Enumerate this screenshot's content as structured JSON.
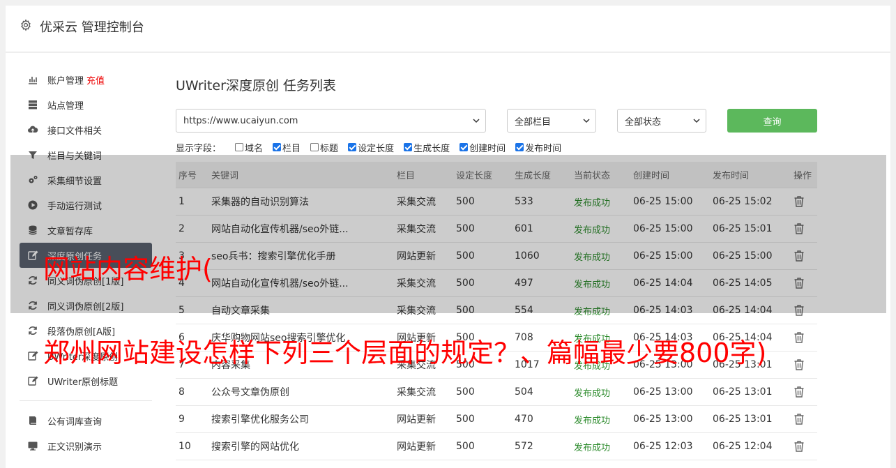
{
  "header": {
    "title": "优采云 管理控制台",
    "icon": "gear-icon"
  },
  "sidebar": {
    "items": [
      {
        "label": "账户管理",
        "badge": "充值",
        "icon": "bar-chart-icon"
      },
      {
        "label": "站点管理",
        "icon": "server-icon"
      },
      {
        "label": "接口文件相关",
        "icon": "cloud-upload-icon"
      },
      {
        "label": "栏目与关键词",
        "icon": "filter-icon"
      },
      {
        "label": "采集细节设置",
        "icon": "cogs-icon"
      },
      {
        "label": "手动运行测试",
        "icon": "play-icon"
      },
      {
        "label": "文章暂存库",
        "icon": "database-icon"
      },
      {
        "label": "深度原创任务",
        "icon": "edit-icon",
        "active": true
      },
      {
        "label": "同义词伪原创[1版]",
        "icon": "refresh-icon"
      },
      {
        "label": "同义词伪原创[2版]",
        "icon": "refresh-icon"
      },
      {
        "label": "段落伪原创[A版]",
        "icon": "refresh-icon"
      },
      {
        "label": "UWriter深度原创",
        "icon": "edit-icon"
      },
      {
        "label": "UWriter原创标题",
        "icon": "edit-icon"
      }
    ],
    "items2": [
      {
        "label": "公有词库查询",
        "icon": "book-icon"
      },
      {
        "label": "正文识别演示",
        "icon": "monitor-icon"
      }
    ]
  },
  "main": {
    "title": "UWriter深度原创 任务列表",
    "site_select": "https://www.ucaiyun.com",
    "column_select": "全部栏目",
    "status_select": "全部状态",
    "query_button": "查询",
    "fields_label": "显示字段：",
    "fields": [
      {
        "label": "域名",
        "checked": false
      },
      {
        "label": "栏目",
        "checked": true
      },
      {
        "label": "标题",
        "checked": false
      },
      {
        "label": "设定长度",
        "checked": true
      },
      {
        "label": "生成长度",
        "checked": true
      },
      {
        "label": "创建时间",
        "checked": true
      },
      {
        "label": "发布时间",
        "checked": true
      }
    ],
    "table": {
      "headers": [
        "序号",
        "关键词",
        "栏目",
        "设定长度",
        "生成长度",
        "当前状态",
        "创建时间",
        "发布时间",
        "操作"
      ],
      "rows": [
        [
          "1",
          "采集器的自动识别算法",
          "采集交流",
          "500",
          "533",
          "发布成功",
          "06-25 15:00",
          "06-25 15:02"
        ],
        [
          "2",
          "网站自动化宣传机器/seo外链...",
          "采集交流",
          "500",
          "601",
          "发布成功",
          "06-25 15:00",
          "06-25 15:01"
        ],
        [
          "3",
          "seo兵书：搜索引擎优化手册",
          "网站更新",
          "500",
          "1060",
          "发布成功",
          "06-25 15:00",
          "06-25 15:00"
        ],
        [
          "4",
          "网站自动化宣传机器/seo外链...",
          "采集交流",
          "500",
          "497",
          "发布成功",
          "06-25 14:04",
          "06-25 14:05"
        ],
        [
          "5",
          "自动文章采集",
          "采集交流",
          "500",
          "554",
          "发布成功",
          "06-25 14:03",
          "06-25 14:04"
        ],
        [
          "6",
          "庆华购物网站seo搜索引擎优化",
          "网站更新",
          "500",
          "708",
          "发布成功",
          "06-25 14:03",
          "06-25 14:04"
        ],
        [
          "7",
          "内容采集",
          "采集交流",
          "500",
          "1017",
          "发布成功",
          "06-25 13:00",
          "06-25 13:01"
        ],
        [
          "8",
          "公众号文章伪原创",
          "采集交流",
          "500",
          "504",
          "发布成功",
          "06-25 13:00",
          "06-25 13:01"
        ],
        [
          "9",
          "搜索引擎优化服务公司",
          "网站更新",
          "500",
          "470",
          "发布成功",
          "06-25 13:00",
          "06-25 13:01"
        ],
        [
          "10",
          "搜索引擎的网站优化",
          "网站更新",
          "500",
          "572",
          "发布成功",
          "06-25 12:03",
          "06-25 12:04"
        ]
      ]
    }
  },
  "overlay": {
    "line1": "网站内容维护(",
    "line2": "郑州网站建设怎样下列三个层面的规定？、篇幅最少要800字)"
  },
  "colors": {
    "accent_green": "#5cb85c",
    "active_nav": "#5a6270",
    "overlay_text": "#ff0000",
    "success": "#2a8a2a"
  }
}
